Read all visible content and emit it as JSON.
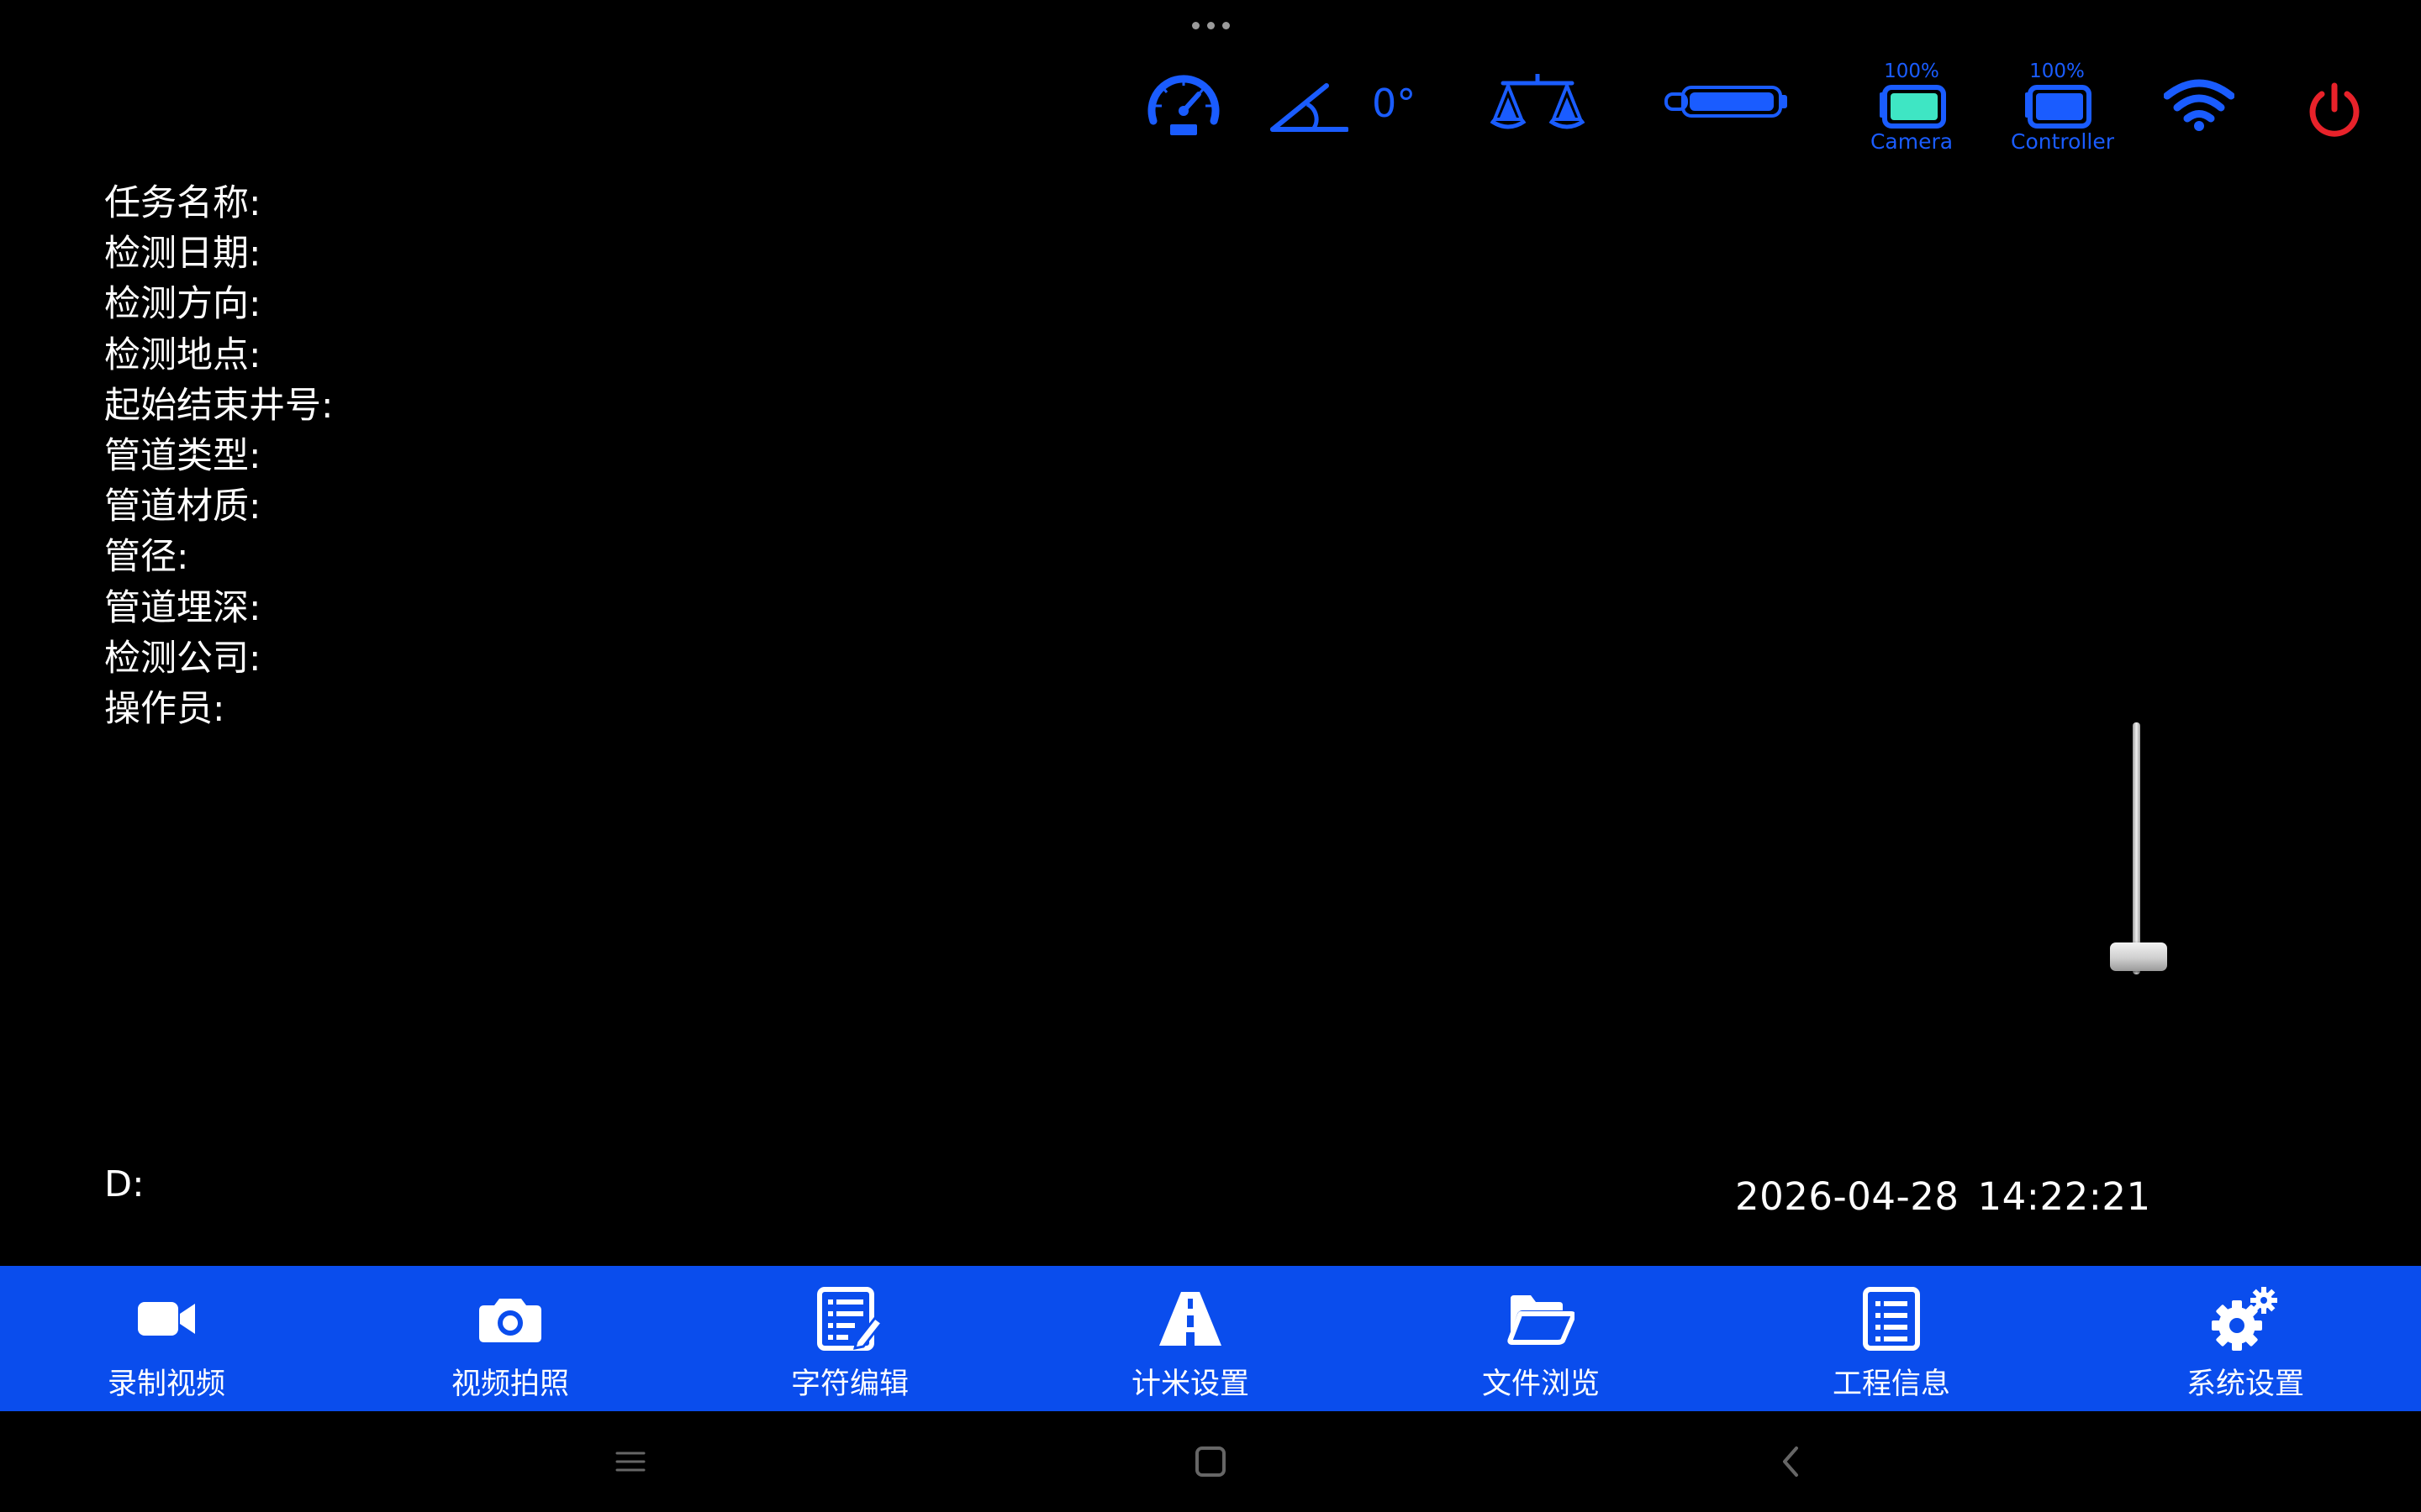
{
  "status_bar": {
    "tilt_value": "0°",
    "camera_battery": {
      "percent": "100%",
      "label": "Camera",
      "level": 1.0
    },
    "controller_battery": {
      "percent": "100%",
      "label": "Controller",
      "level": 1.0
    },
    "icons": [
      "speedometer-icon",
      "tilt-angle-icon",
      "balance-scale-icon",
      "probe-icon",
      "camera-battery-icon",
      "controller-battery-icon",
      "wifi-icon",
      "power-icon"
    ],
    "colors": {
      "accent": "#1a5cff",
      "battery_fill": "#3ee6c4",
      "power": "#e8222a"
    }
  },
  "info_fields": [
    {
      "label": "任务名称:"
    },
    {
      "label": "检测日期:"
    },
    {
      "label": "检测方向:"
    },
    {
      "label": "检测地点:"
    },
    {
      "label": "起始结束井号:"
    },
    {
      "label": "管道类型:"
    },
    {
      "label": "管道材质:"
    },
    {
      "label": "管径:"
    },
    {
      "label": "管道埋深:"
    },
    {
      "label": "检测公司:"
    },
    {
      "label": "操作员:"
    }
  ],
  "slider": {
    "level": 0.0
  },
  "distance_label": "D:",
  "datetime": {
    "date": "2026-04-28",
    "time": "14:22:21"
  },
  "toolbar": {
    "background": "#0a4ded",
    "buttons": [
      {
        "label": "录制视频",
        "icon": "video-camera-icon"
      },
      {
        "label": "视频拍照",
        "icon": "photo-camera-icon"
      },
      {
        "label": "字符编辑",
        "icon": "edit-document-icon"
      },
      {
        "label": "计米设置",
        "icon": "road-icon"
      },
      {
        "label": "文件浏览",
        "icon": "folder-icon"
      },
      {
        "label": "工程信息",
        "icon": "list-document-icon"
      },
      {
        "label": "系统设置",
        "icon": "gears-icon"
      }
    ]
  },
  "nav_bar": {
    "icons": [
      "menu-icon",
      "home-icon",
      "back-icon"
    ]
  }
}
